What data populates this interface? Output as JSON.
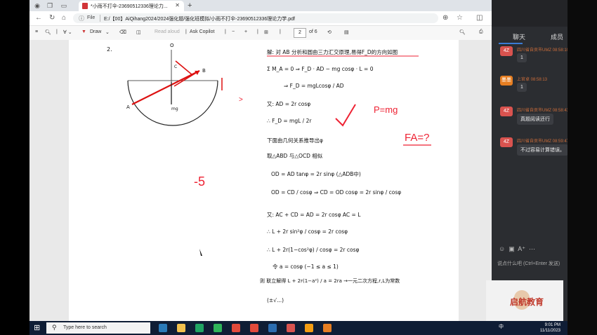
{
  "browser": {
    "tab_title": "*小雨不打伞-23690512336理论力学 ×",
    "tab_title_short": "*小雨不打伞-23690512336理论力...",
    "address_label": "File",
    "url": "E:/【00】AiQihang2024/2024强化题/强化班模拟/小雨不打伞-23690512336理论力学.pdf"
  },
  "pdf_toolbar": {
    "draw_label": "Draw",
    "read_aloud_label": "Read aloud",
    "ask_copilot_label": "Ask Copilot",
    "page_current": "2",
    "page_total": "of 6"
  },
  "page": {
    "problem_number": "2.",
    "grade_mark": "-5",
    "p_eq": "P=mg",
    "fa_question": "FA=?",
    "lines": [
      "解: 对 AB 分析和圆由三力汇交原理,易得F_D的方向如图",
      "Σ M_A = 0 ⇒ F_D · AD − mg cosφ · L = 0",
      "⇒ F_D = mgLcosφ / AD",
      "又: AD = 2r cosφ",
      "∴ F_D = mgL / 2r",
      "下面由几何关系推导出φ",
      "取△ABD 与△OCD 相似",
      "OD = AD tanφ = 2r sinφ   (△ADB中)",
      "OD = CD / cosφ ⇒ CD = OD cosφ = 2r sinφ / cosφ",
      "又: AC + CD = AD = 2r cosφ     AC = L",
      "∴ L + 2r sin²φ / cosφ = 2r cosφ",
      "∴ L + 2r(1−cos²φ) / cosφ = 2r cosφ",
      "令 a = cosφ   (−1 ≤ a ≤ 1)",
      "则 联立解得 L + 2r(1−a²) / a = 2ra   →一元二次方程,r,L为常数",
      "(±√...)"
    ]
  },
  "chat": {
    "tab_chat": "聊天",
    "tab_members": "成员",
    "messages": [
      {
        "avatar": "4Z",
        "name": "四川省自贡市UMZ 08:58:10",
        "text": "1",
        "avatar_color": "#d9534f"
      },
      {
        "avatar": "墨墨",
        "name": "上官卓 08:58:13",
        "text": "1",
        "avatar_color": "#e67e22"
      },
      {
        "avatar": "4Z",
        "name": "四川省自贡市UMZ 08:58:43",
        "text": "真题阅读还行",
        "avatar_color": "#d9534f"
      },
      {
        "avatar": "4Z",
        "name": "四川省自贡市UMZ 08:59:47",
        "text": "不过容易计算错误。",
        "avatar_color": "#d9534f"
      }
    ],
    "input_placeholder": "说点什么吧 (Ctrl+Enter 发送)"
  },
  "camera": {
    "brand": "启航教育"
  },
  "taskbar": {
    "search_placeholder": "Type here to search",
    "tray_lang": "中",
    "time": "9:01 PM",
    "date": "11/11/2023"
  },
  "colors": {
    "accent_red": "#e22233",
    "taskbar": "#0f1d35",
    "chat_bg": "#2b2d31"
  }
}
